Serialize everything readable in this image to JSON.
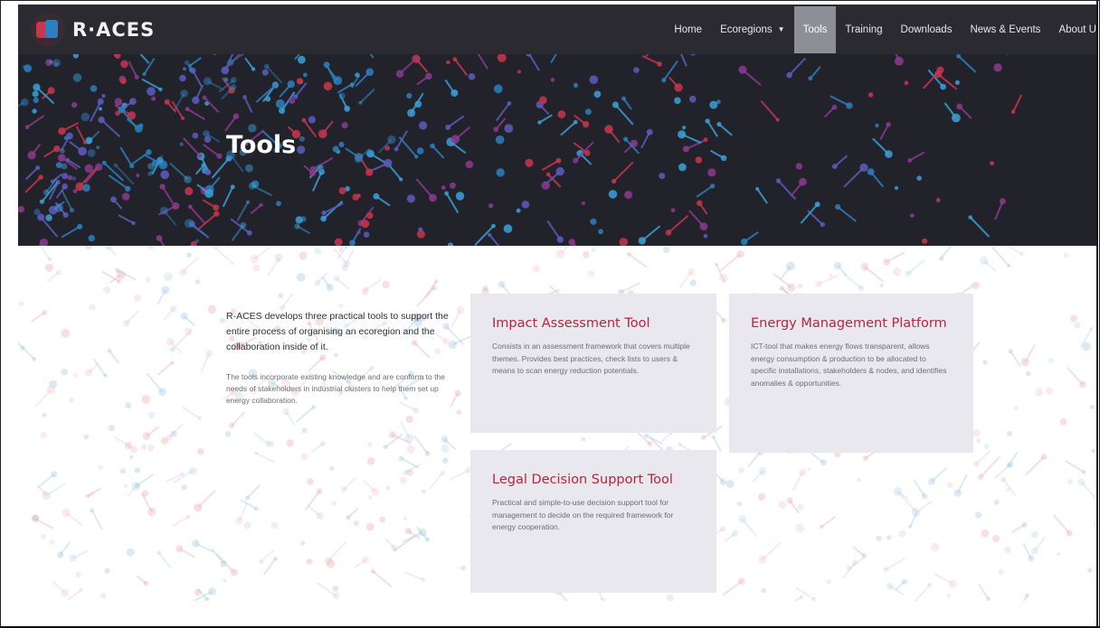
{
  "brand": {
    "name": "R·ACES",
    "logo_icon": "r-aces-logo-icon"
  },
  "nav": {
    "items": [
      {
        "label": "Home",
        "active": false
      },
      {
        "label": "Ecoregions",
        "active": false,
        "dropdown": true
      },
      {
        "label": "Tools",
        "active": true
      },
      {
        "label": "Training",
        "active": false
      },
      {
        "label": "Downloads",
        "active": false
      },
      {
        "label": "News & Events",
        "active": false
      },
      {
        "label": "About U",
        "active": false
      }
    ],
    "dropdown_icon": "chevron-down-icon"
  },
  "hero": {
    "title": "Tools"
  },
  "intro": {
    "lead": "R-ACES develops three practical tools to support the entire process of organising an ecoregion and the collaboration inside of it.",
    "body": "The tools incorporate existing knowledge and are conform to the needs of stakeholders in industrial clusters to help them set up energy collaboration."
  },
  "cards": [
    {
      "title": "Impact Assessment Tool",
      "text": "Consists in an assessment framework that covers multiple themes. Provides best practices, check lists to users & means to scan energy reduction potentials."
    },
    {
      "title": "Energy Management Platform",
      "text": "ICT-tool that makes energy flows transparent, allows energy consumption & production to be allocated to specific installations, stakeholders & nodes, and identifies anomalies & opportunities."
    },
    {
      "title": "Legal Decision Support Tool",
      "text": "Practical and simple-to-use decision support tool for management to decide on the required framework for energy cooperation."
    }
  ],
  "colors": {
    "nav_bg": "#2a2a30",
    "hero_bg": "#22222a",
    "accent_red": "#b8243c",
    "accent_blue": "#2d7fc0",
    "card_bg": "#eae8ef",
    "active_nav_bg": "#8d8e96"
  }
}
